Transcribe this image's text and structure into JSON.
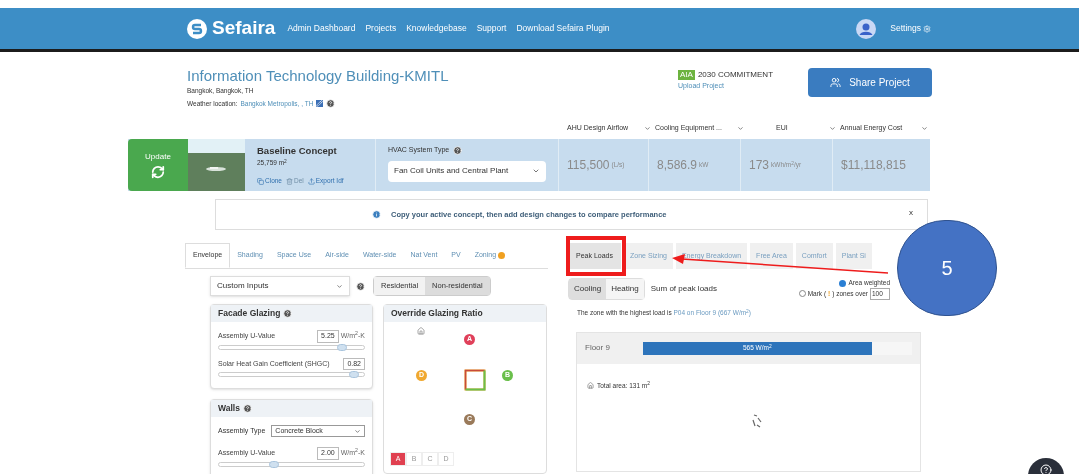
{
  "header": {
    "brand": "Sefaira",
    "nav": [
      "Admin Dashboard",
      "Projects",
      "Knowledgebase",
      "Support",
      "Download Sefaira Plugin"
    ],
    "settings": "Settings"
  },
  "project": {
    "title": "Information Technology Building-KMITL",
    "location": "Bangkok, Bangkok, TH",
    "weather_label": "Weather location:",
    "weather_link": "Bangkok Metropolis, , TH",
    "badge": "AIA",
    "commitment": "2030 COMMITMENT",
    "upload": "Upload Project",
    "share": "Share Project"
  },
  "metric_columns": [
    "AHU Design Airflow",
    "Cooling Equipment ...",
    "EUI",
    "Annual Energy Cost"
  ],
  "concept": {
    "update": "Update",
    "name": "Baseline Concept",
    "area": "25,759 m$^{2}$",
    "actions": [
      {
        "label": "Clone",
        "disabled": false
      },
      {
        "label": "Del",
        "disabled": true
      },
      {
        "label": "Export Idf",
        "disabled": false
      }
    ],
    "hvac_label": "HVAC System Type",
    "hvac_value": "Fan Coil Units and Central Plant",
    "metrics": [
      {
        "value": "115,500",
        "unit": "(L/s)"
      },
      {
        "value": "8,586.9",
        "unit": "kW"
      },
      {
        "value": "173",
        "unit": "kWh/m$^{2}$/yr"
      },
      {
        "value": "$11,118,815"
      }
    ]
  },
  "banner": {
    "text": "Copy your active concept, then add design changes to compare performance",
    "close": "x"
  },
  "left_tabs": [
    {
      "label": "Envelope",
      "selected": true,
      "warning": false
    },
    {
      "label": "Shading",
      "selected": false,
      "warning": false
    },
    {
      "label": "Space Use",
      "selected": false,
      "warning": false
    },
    {
      "label": "Air-side",
      "selected": false,
      "warning": false
    },
    {
      "label": "Water-side",
      "selected": false,
      "warning": false
    },
    {
      "label": "Nat Vent",
      "selected": false,
      "warning": false
    },
    {
      "label": "PV",
      "selected": false,
      "warning": false
    },
    {
      "label": "Zoning",
      "selected": false,
      "warning": true
    }
  ],
  "inputs_select": "Custom Inputs",
  "type_toggle": [
    {
      "label": "Residential",
      "selected": false
    },
    {
      "label": "Non-residential",
      "selected": true
    }
  ],
  "facade": {
    "title": "Facade Glazing",
    "fields": [
      {
        "label": "Assembly U-Value",
        "value": "5.25",
        "unit": "W/m$^{2}$-K",
        "level": 0.85
      },
      {
        "label": "Solar Heat Gain Coefficient (SHGC)",
        "value": "0.82",
        "level": 0.93
      }
    ]
  },
  "walls": {
    "title": "Walls",
    "type_label": "Assembly Type",
    "type_value": "Concrete Block",
    "fields": [
      {
        "label": "Assembly U-Value",
        "value": "2.00",
        "unit": "W/m$^{2}$-K",
        "level": 0.38
      }
    ]
  },
  "glazing": {
    "title": "Override Glazing Ratio",
    "markers": [
      {
        "label": "A",
        "color": "#e0405a"
      },
      {
        "label": "B",
        "color": "#6abf4b"
      },
      {
        "label": "C",
        "color": "#9a7a5a"
      },
      {
        "label": "D",
        "color": "#f0a830"
      }
    ],
    "facade_tabs": [
      {
        "label": "A",
        "selected": true
      },
      {
        "label": "B",
        "selected": false
      },
      {
        "label": "C",
        "selected": false
      },
      {
        "label": "D",
        "selected": false
      }
    ]
  },
  "right_tabs": [
    {
      "label": "Peak Loads",
      "selected": true
    },
    {
      "label": "Zone Sizing",
      "selected": false
    },
    {
      "label": "Energy Breakdown",
      "selected": false
    },
    {
      "label": "Free Area",
      "selected": false
    },
    {
      "label": "Comfort",
      "selected": false
    },
    {
      "label": "Plant Si",
      "selected": false
    }
  ],
  "load_toggle": [
    {
      "label": "Cooling",
      "selected": true
    },
    {
      "label": "Heating",
      "selected": false
    }
  ],
  "sum_label": "Sum of peak loads",
  "area_weighted": {
    "label": "Area weighted",
    "checked": true
  },
  "mark": {
    "checked": false,
    "prefix": "Mark (",
    "icon": "!",
    "suffix": ") zones over",
    "value": "100"
  },
  "highest": {
    "text": "The zone with the highest load is",
    "link": "P04 on Floor 9 (667 W/m$^{2}$)"
  },
  "floor": {
    "name": "Floor 9",
    "reading": "565 W/m$^{2}$",
    "level": 0.85,
    "total_area": "Total area: 131 m$^{2}$"
  },
  "annotation": {
    "step": "5"
  }
}
